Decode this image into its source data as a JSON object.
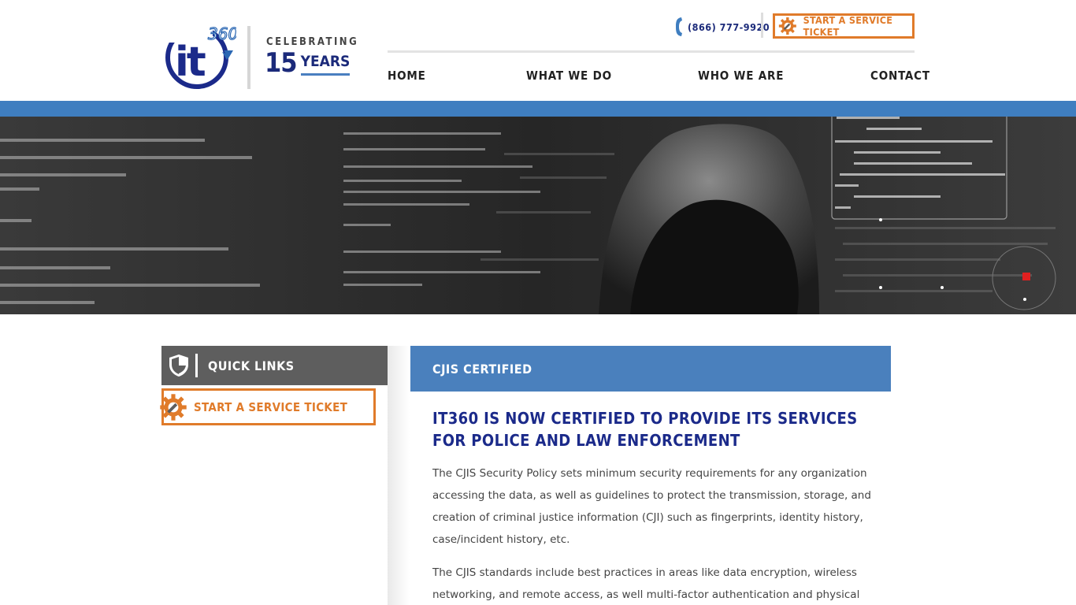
{
  "header": {
    "celebrating": "CELEBRATING",
    "years_number": "15",
    "years_word": "YEARS",
    "phone": "(866) 777-9920",
    "ticket_label": "START A SERVICE TICKET",
    "nav": [
      "HOME",
      "WHAT WE DO",
      "WHO WE ARE",
      "CONTACT"
    ]
  },
  "sidebar": {
    "title": "QUICK LINKS",
    "ticket_label": "START A SERVICE TICKET"
  },
  "main": {
    "section_title": "CJIS CERTIFIED",
    "heading": "IT360 IS NOW CERTIFIED TO PROVIDE ITS SERVICES FOR POLICE AND LAW ENFORCEMENT",
    "paragraphs": [
      "The CJIS Security Policy sets minimum security requirements for any organization accessing the data, as well as guidelines to protect the transmission, storage, and creation of criminal justice information (CJI) such as fingerprints, identity history, case/incident history, etc.",
      "The CJIS standards include best practices in areas like data encryption, wireless networking, and remote access, as well multi-factor authentication and physical security."
    ]
  },
  "colors": {
    "brand_navy": "#1b2a7a",
    "brand_blue": "#3f7ec0",
    "accent_orange": "#e07b2a",
    "sidebar_gray": "#5e5e5e"
  },
  "icons": {
    "phone": "phone-icon",
    "gear": "gear-wrench-icon",
    "shield": "shield-icon"
  }
}
